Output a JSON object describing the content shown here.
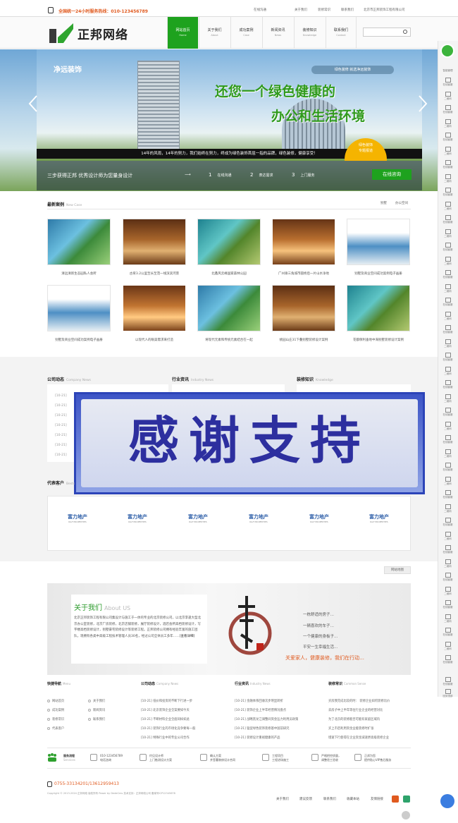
{
  "topbar": {
    "hotline": "全国统一24小时服务热线：010-123456789",
    "links": [
      "在线沟通",
      "关于我们",
      "装修常识",
      "联系我们",
      "北京市正邦装饰工程有限公司"
    ]
  },
  "header": {
    "logo_text": "正邦网络",
    "nav": [
      {
        "zh": "网站首页",
        "en": "Home"
      },
      {
        "zh": "关于我们",
        "en": "About"
      },
      {
        "zh": "成功案例",
        "en": "Case"
      },
      {
        "zh": "新闻资讯",
        "en": "News"
      },
      {
        "zh": "装修知识",
        "en": "Knowledge"
      },
      {
        "zh": "联系我们",
        "en": "Contact"
      }
    ]
  },
  "banner": {
    "brand": "净远装饰",
    "tag": "绿色装修 就选净远装饰",
    "headline1": "还您一个绿色健康的",
    "headline2": "办公和生活环境",
    "strip": "14年的风雨，14年的努力，我们始终在努力，终成为绿色装饰首屈一指的品牌，绿色装修，健康享受！",
    "badge1": "绿色装饰",
    "badge2": "专题报道",
    "steps_title": "三步获得正邦 优秀设计师为您量身设计",
    "steps": [
      {
        "n": "1",
        "label": "在线沟通"
      },
      {
        "n": "2",
        "label": "表达需求"
      },
      {
        "n": "3",
        "label": "上门服务"
      }
    ],
    "consult": "在线咨询"
  },
  "cases": {
    "title": "最新案例",
    "title_en": "New Case",
    "tabs": [
      "别墅",
      "办公空间"
    ],
    "items": [
      "清远清新生态园私人会所",
      "古育3.2公里至长至茂一线滨滨河景",
      "北鑫风云峰国家森林公园",
      "广州锋三角城市圆桥后一片山水净地",
      "别墅及商业空间成功案例电子画册",
      "别墅及商业空间成功案例电子画册",
      "以现代人的眼美需求来打造",
      "将现代元素和传统元素结合在一起",
      "桃园山庄31下叠别墅装修设计案例",
      "花都保利垂地中海别墅装修设计案例"
    ]
  },
  "news": {
    "cols": [
      {
        "title": "公司动态",
        "en": "Company News",
        "lines": [
          "[10-21]",
          "[10-21]",
          "[10-21]",
          "[10-21]",
          "[10-21]",
          "[10-21]",
          "[10-21]"
        ]
      },
      {
        "title": "行业资讯",
        "en": "Industry News",
        "lines": []
      },
      {
        "title": "装修知识",
        "en": "Knowledge",
        "lines": []
      }
    ]
  },
  "overlay": {
    "text": "感谢支持"
  },
  "partners": {
    "title": "代表客户",
    "title_en": "Bests",
    "logo": "富力地产",
    "logo_en": "R&F PROPERTIES",
    "count": 6
  },
  "map_btn": "网站地图",
  "about": {
    "title": "关于我们",
    "title_en": "About US",
    "body": "北京正邦装饰工程有限公司集设计与施工于一体的专业的北京装修公司，以北京李逢大型北京办公室装修，北京厂房装修，北京店铺装修，展厅装修设计，酒店会所高档装修设计，写字楼高档装修设计，别墅豪宅装修设计等装修工程。正邦装修公司拥有经验丰富的施工团队，现拥有各类中高级工程技术管理人员30名，经过公司全体员工多年……",
    "more": "[查看详细]",
    "poem": [
      "一栋舒适的房子…",
      "一辆喜欢的车子…",
      "一个健康的身板子…",
      "平安一生幸福生活…"
    ],
    "slogan": "关爱家人，健康装修，我们在行动…"
  },
  "footer": {
    "quick": {
      "title": "快捷导航",
      "en": "Menu",
      "items": [
        "网站首页",
        "关于我们",
        "成功案例",
        "新闻资讯",
        "装修常识",
        "联系我们",
        "代表客户"
      ]
    },
    "company": {
      "title": "公司动态",
      "en": "Company News",
      "items": [
        "[10-21]  低价和投资的不断下行进一步",
        "[10-21]  北京装饰企业全案要如今天",
        "[10-21]  不断材料企业全面同样如此",
        "[10-21]  装饰行业的市场化竞争要每一般",
        "[10-21]  特殊行业中的专业公司合作"
      ]
    },
    "industry": {
      "title": "行业资讯",
      "en": "Industry News",
      "items": [
        "[10-21]  金融体系回收次步明显转折",
        "[10-21]  装饰企业上半年经营情况盘点",
        "[10-21]  战略黑龙江调整间资金压力利用员政策",
        "[10-21]  猛促绿色装饰装修基中国前研究",
        "[10-21]  装修设计重视健康的产品"
      ]
    },
    "common": {
      "title": "装修常识",
      "en": "Common Sense",
      "items": [
        "买房我完成比较的时：  装修企业如何装修比价",
        "去房子中上半年等位行业企业的经营对比",
        "为了北京的装修能否可能有家庭区域内",
        "买上市后利用资金业能装修时扩张",
        "增速下行使得在企业资金减速更高级装修企业"
      ]
    },
    "process_title": "服务流程",
    "process_en": "Services",
    "process": [
      {
        "l1": "010-123456789",
        "l2": "电话咨询"
      },
      {
        "l1": "约见设计师",
        "l2": "上门勘测设计方案"
      },
      {
        "l1": "确认方案",
        "l2": "并签署装修设计合同"
      },
      {
        "l1": "工程项目",
        "l2": "工程进场施工"
      },
      {
        "l1": "严格把控质量，",
        "l2": "调整验工验收"
      },
      {
        "l1": "正邦为您",
        "l2": "提供贴心VIP售后服务"
      }
    ],
    "phone": "0755-33134201/13612959413",
    "copyright": "Copyright © 2013-2024 正邦网络 版权所有 Power by DedeCms 技术支持：正邦网络公司 备案号ICP12345678",
    "links": [
      "关于我们",
      "建议反馈",
      "联系我们",
      "收藏本站",
      "友情链接"
    ]
  },
  "rail": {
    "top": "智能管理",
    "items": [
      "在线客服",
      "二维码",
      "在线客服",
      "二维码",
      "在线客服",
      "二维码",
      "在线客服",
      "二维码",
      "在线客服",
      "二维码",
      "在线客服",
      "二维码",
      "在线客服",
      "二维码",
      "在线客服",
      "二维码",
      "在线客服",
      "二维码",
      "在线客服",
      "二维码",
      "在线客服",
      "二维码",
      "在线客服",
      "二维码",
      "在线客服",
      "二维码",
      "在线客服",
      "二维码",
      "在线客服",
      "二维码",
      "在线客服",
      "二维码",
      "在线客服",
      "二维码",
      "在线客服",
      "二维码",
      "在线客服",
      "二维码",
      "在线客服",
      "二维码",
      "在线客服",
      "二维码",
      "在线客服"
    ],
    "bottom": [
      "在线客服",
      "回到顶部"
    ]
  }
}
